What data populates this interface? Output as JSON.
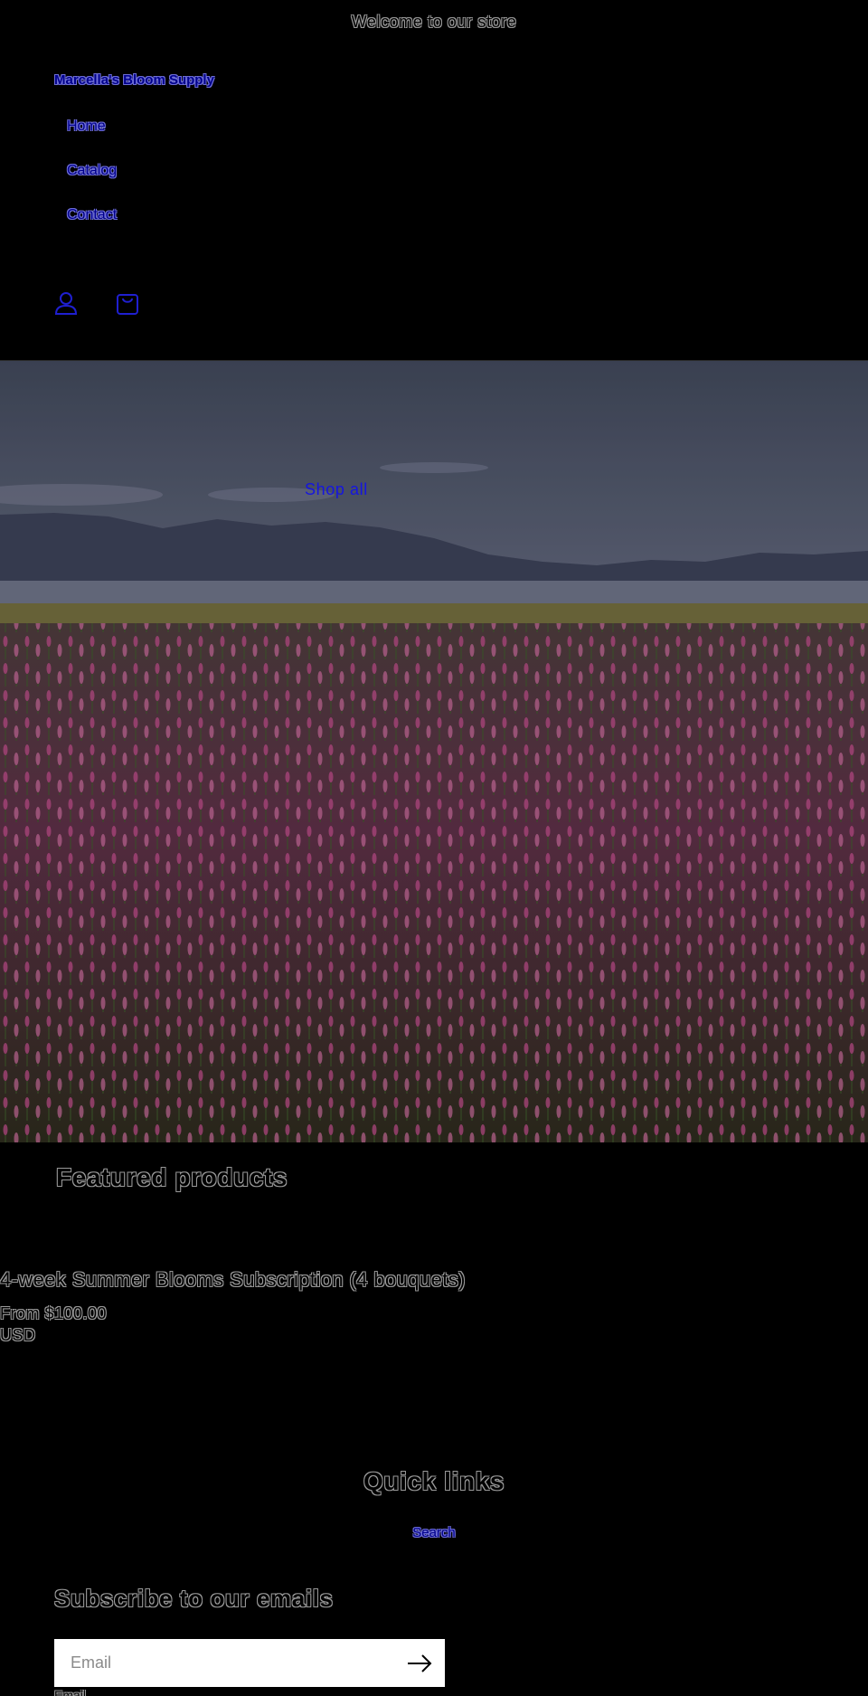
{
  "announcement": {
    "text": "Welcome to our store"
  },
  "header": {
    "store_name": "Marcella's Bloom Supply",
    "nav": [
      {
        "label": "Home"
      },
      {
        "label": "Catalog"
      },
      {
        "label": "Contact"
      }
    ],
    "icons": {
      "account": "user-icon",
      "cart": "bag-icon"
    }
  },
  "hero": {
    "cta_label": "Shop all"
  },
  "featured": {
    "title": "Featured products",
    "product": {
      "title": "4-week Summer Blooms Subscription (4 bouquets)",
      "price": "From $100.00 USD"
    }
  },
  "footer": {
    "quick_links_title": "Quick links",
    "search_label": "Search",
    "subscribe_title": "Subscribe to our emails",
    "email_placeholder": "Email",
    "email_label": "Email",
    "submit_icon": "arrow-right-icon"
  },
  "colors": {
    "background": "#000000",
    "link": "#1515e0",
    "icon": "#1f1fd0"
  }
}
